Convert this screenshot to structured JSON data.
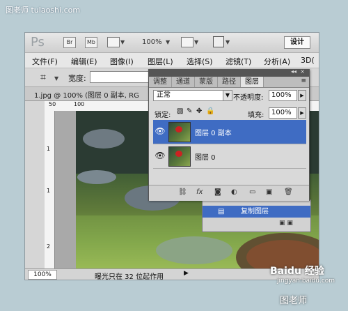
{
  "watermark_top": "图老师 tulaoshi.com",
  "app": {
    "logo": "Ps",
    "bridge": "Br",
    "minibridge": "Mb",
    "zoom": "100%",
    "workspace": "设计"
  },
  "menus": [
    "文件(F)",
    "编辑(E)",
    "图像(I)",
    "图层(L)",
    "选择(S)",
    "滤镜(T)",
    "分析(A)",
    "3D("
  ],
  "options": {
    "width_label": "宽度:"
  },
  "document": {
    "title": "1.jpg @ 100% (图层 0 副本, RG"
  },
  "ruler": {
    "h_labels": [
      "50",
      "100"
    ],
    "v_labels": [
      "1",
      "1",
      "2"
    ]
  },
  "panel": {
    "tabs": [
      "调整",
      "通道",
      "蒙版",
      "路径",
      "图层"
    ],
    "active_tab": "图层",
    "blend_mode": "正常",
    "opacity_label": "不透明度:",
    "opacity_value": "100%",
    "lock_label": "锁定:",
    "fill_label": "填充:",
    "fill_value": "100%",
    "layers": [
      {
        "name": "图层 0 副本",
        "selected": true,
        "visible": true
      },
      {
        "name": "图层 0",
        "selected": false,
        "visible": true
      }
    ]
  },
  "history": {
    "item": "复制图层"
  },
  "status": {
    "zoom": "100%",
    "text": "曝光只在 32 位起作用"
  },
  "watermark_bottom": {
    "brand": "Baidu 经验",
    "url": "jingyan.baidu.com",
    "site": "图老师"
  },
  "colors": {
    "selection": "#3f6cc3",
    "panel_bg": "#d9d9d9",
    "page_bg": "#b9ccd3"
  }
}
